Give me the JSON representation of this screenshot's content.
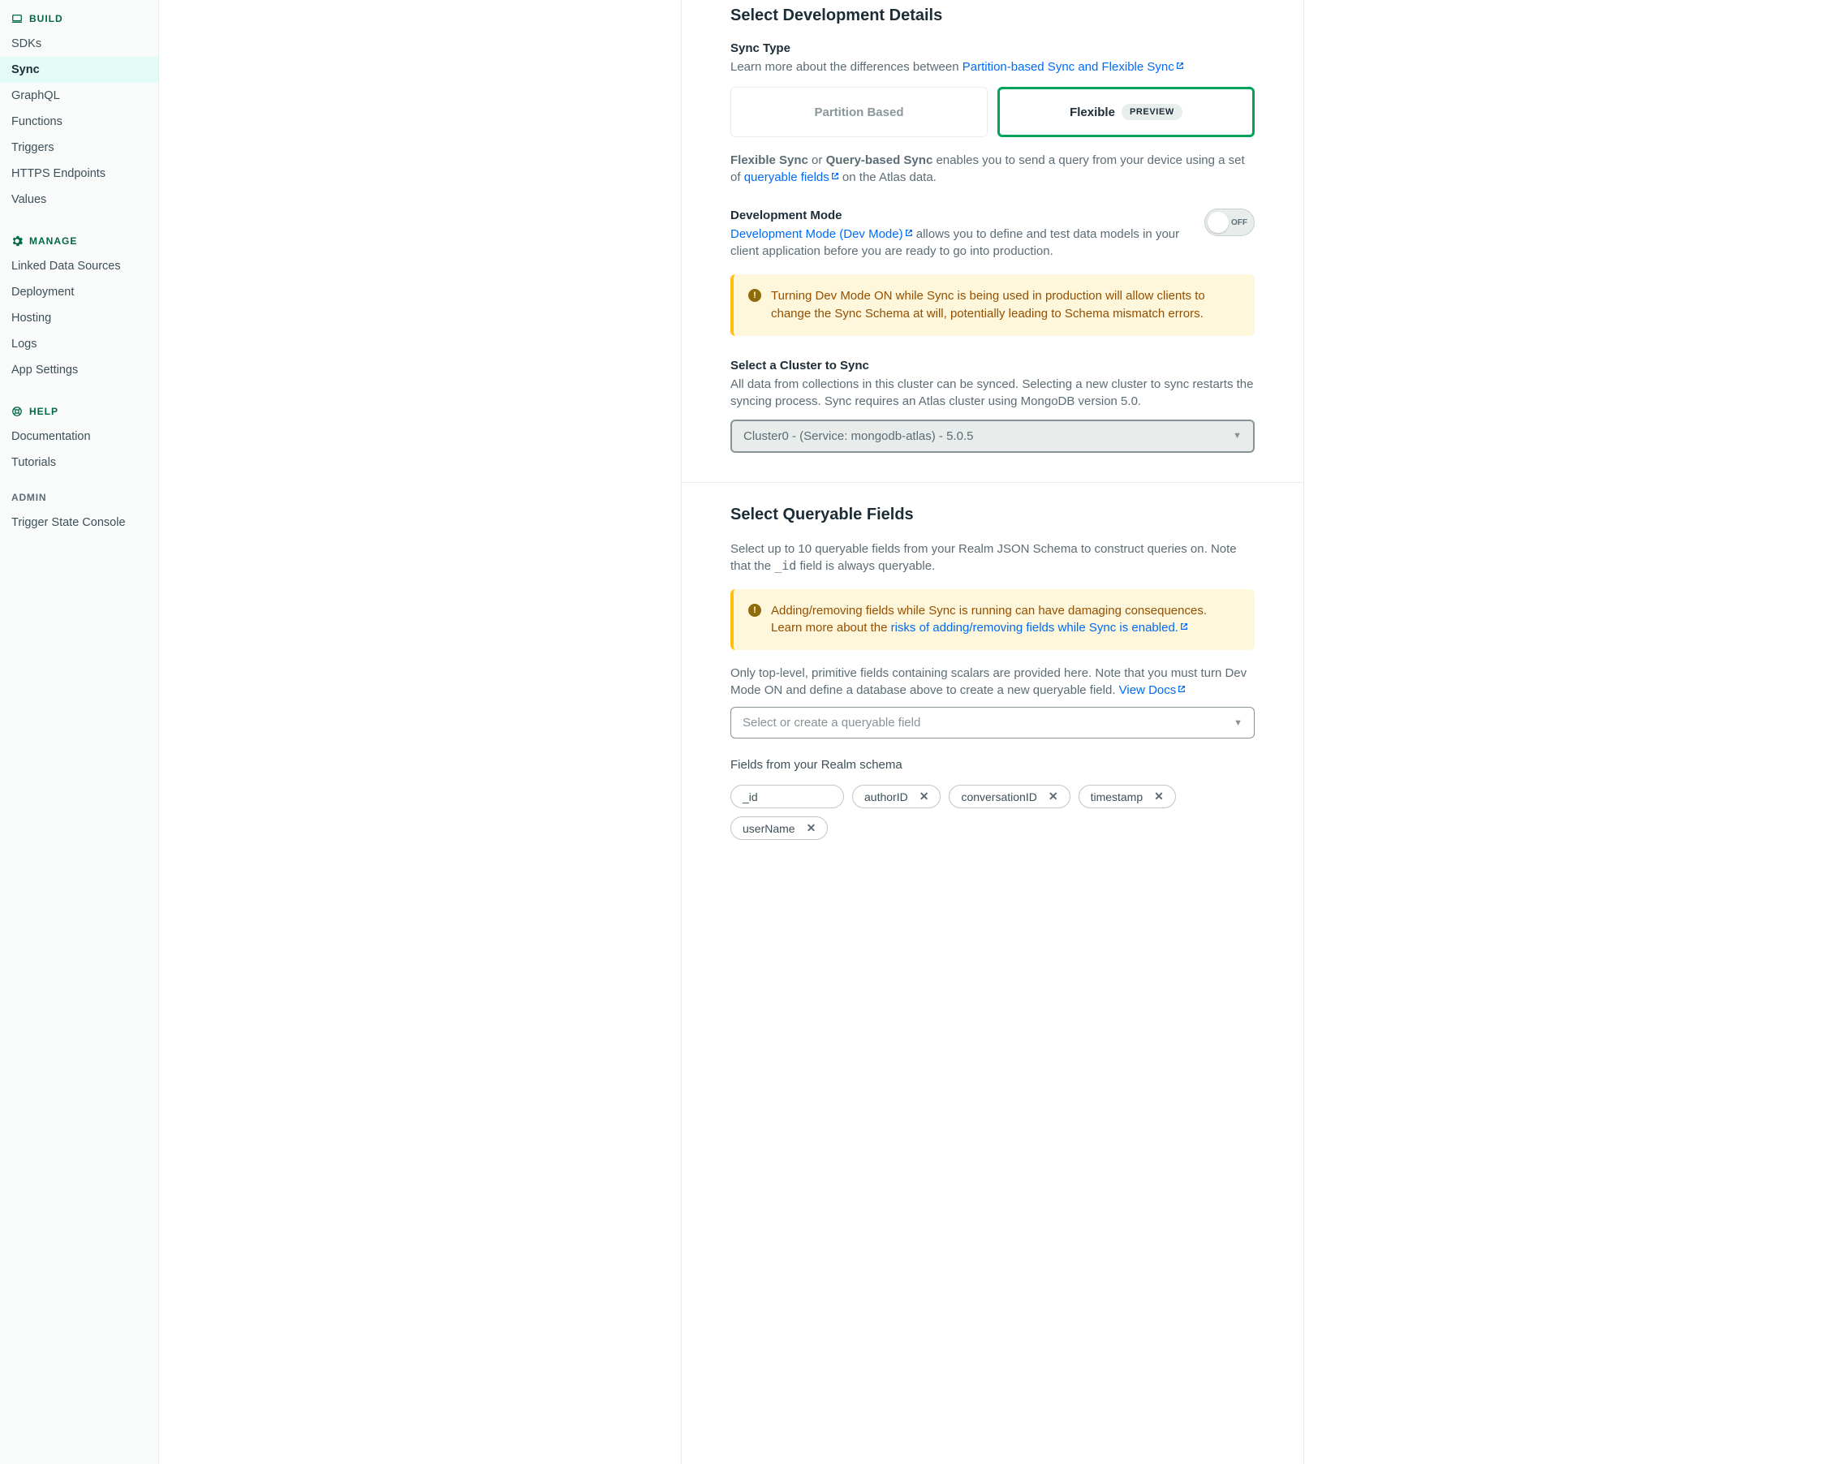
{
  "sidebar": {
    "build_label": "BUILD",
    "build_items": [
      "SDKs",
      "Sync",
      "GraphQL",
      "Functions",
      "Triggers",
      "HTTPS Endpoints",
      "Values"
    ],
    "build_active_index": 1,
    "manage_label": "MANAGE",
    "manage_items": [
      "Linked Data Sources",
      "Deployment",
      "Hosting",
      "Logs",
      "App Settings"
    ],
    "help_label": "HELP",
    "help_items": [
      "Documentation",
      "Tutorials"
    ],
    "admin_label": "ADMIN",
    "admin_items": [
      "Trigger State Console"
    ]
  },
  "dev_details": {
    "title": "Select Development Details",
    "sync_type": {
      "label": "Sync Type",
      "learn_prefix": "Learn more about the differences between ",
      "learn_link": "Partition-based Sync and Flexible Sync",
      "tab_partition": "Partition Based",
      "tab_flexible": "Flexible",
      "flexible_badge": "PREVIEW",
      "para_strong1": "Flexible Sync",
      "para_mid": " or ",
      "para_strong2": "Query-based Sync",
      "para_tail1": " enables you to send a query from your device using a set of ",
      "para_link": "queryable fields",
      "para_tail2": " on the Atlas data."
    },
    "dev_mode": {
      "label": "Development Mode",
      "link": "Development Mode (Dev Mode)",
      "tail": "  allows you to define and test data models in your client application before you are ready to go into production.",
      "toggle_state": "OFF",
      "warning": "Turning Dev Mode ON while Sync is being used in production will allow clients to change the Sync Schema at will, potentially leading to Schema mismatch errors."
    },
    "cluster": {
      "label": "Select a Cluster to Sync",
      "desc": "All data from collections in this cluster can be synced. Selecting a new cluster to sync restarts the syncing process. Sync requires an Atlas cluster using MongoDB version 5.0.",
      "selected": "Cluster0 - (Service: mongodb-atlas) - 5.0.5"
    }
  },
  "queryable": {
    "title": "Select Queryable Fields",
    "desc_pre": "Select up to 10 queryable fields from your Realm JSON Schema to construct queries on. Note that the ",
    "desc_code": "_id",
    "desc_post": " field is always queryable.",
    "warn_pre": "Adding/removing fields while Sync is running can have damaging consequences. Learn more about the ",
    "warn_link": "risks of adding/removing fields while Sync is enabled.",
    "note_pre": "Only top-level, primitive fields containing scalars are provided here. Note that you must turn Dev Mode ON and define a database above to create a new queryable field. ",
    "note_link": "View Docs",
    "select_placeholder": "Select or create a queryable field",
    "fields_label": "Fields from your Realm schema",
    "readonly_field": "_id",
    "fields": [
      "authorID",
      "conversationID",
      "timestamp",
      "userName"
    ]
  }
}
